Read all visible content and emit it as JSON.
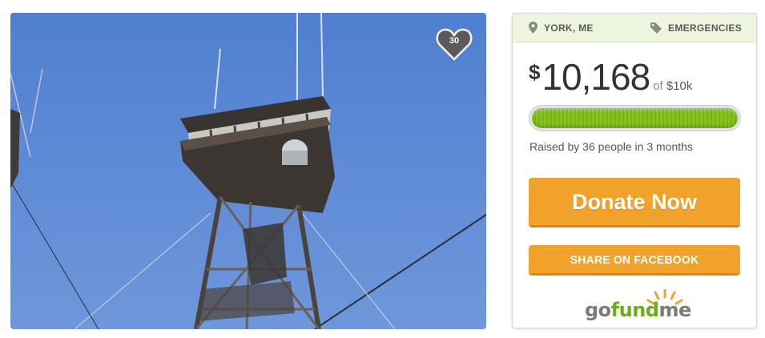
{
  "photo": {
    "likes": "30"
  },
  "card": {
    "location": "YORK, ME",
    "category": "EMERGENCIES",
    "currency": "$",
    "amount": "10,168",
    "goal_prefix": "of",
    "goal": "$10k",
    "progress": 1.0,
    "raised_prefix": "Raised by",
    "raised_people": "36",
    "raised_mid": "people in",
    "raised_time": "3 months",
    "donate_label": "Donate Now",
    "share_label": "SHARE ON FACEBOOK",
    "logo": {
      "go": "go",
      "fund": "fund",
      "me": "me"
    }
  },
  "colors": {
    "accent": "#f0a22a",
    "progress": "#84c21f",
    "meta_bg": "#eef5df"
  }
}
